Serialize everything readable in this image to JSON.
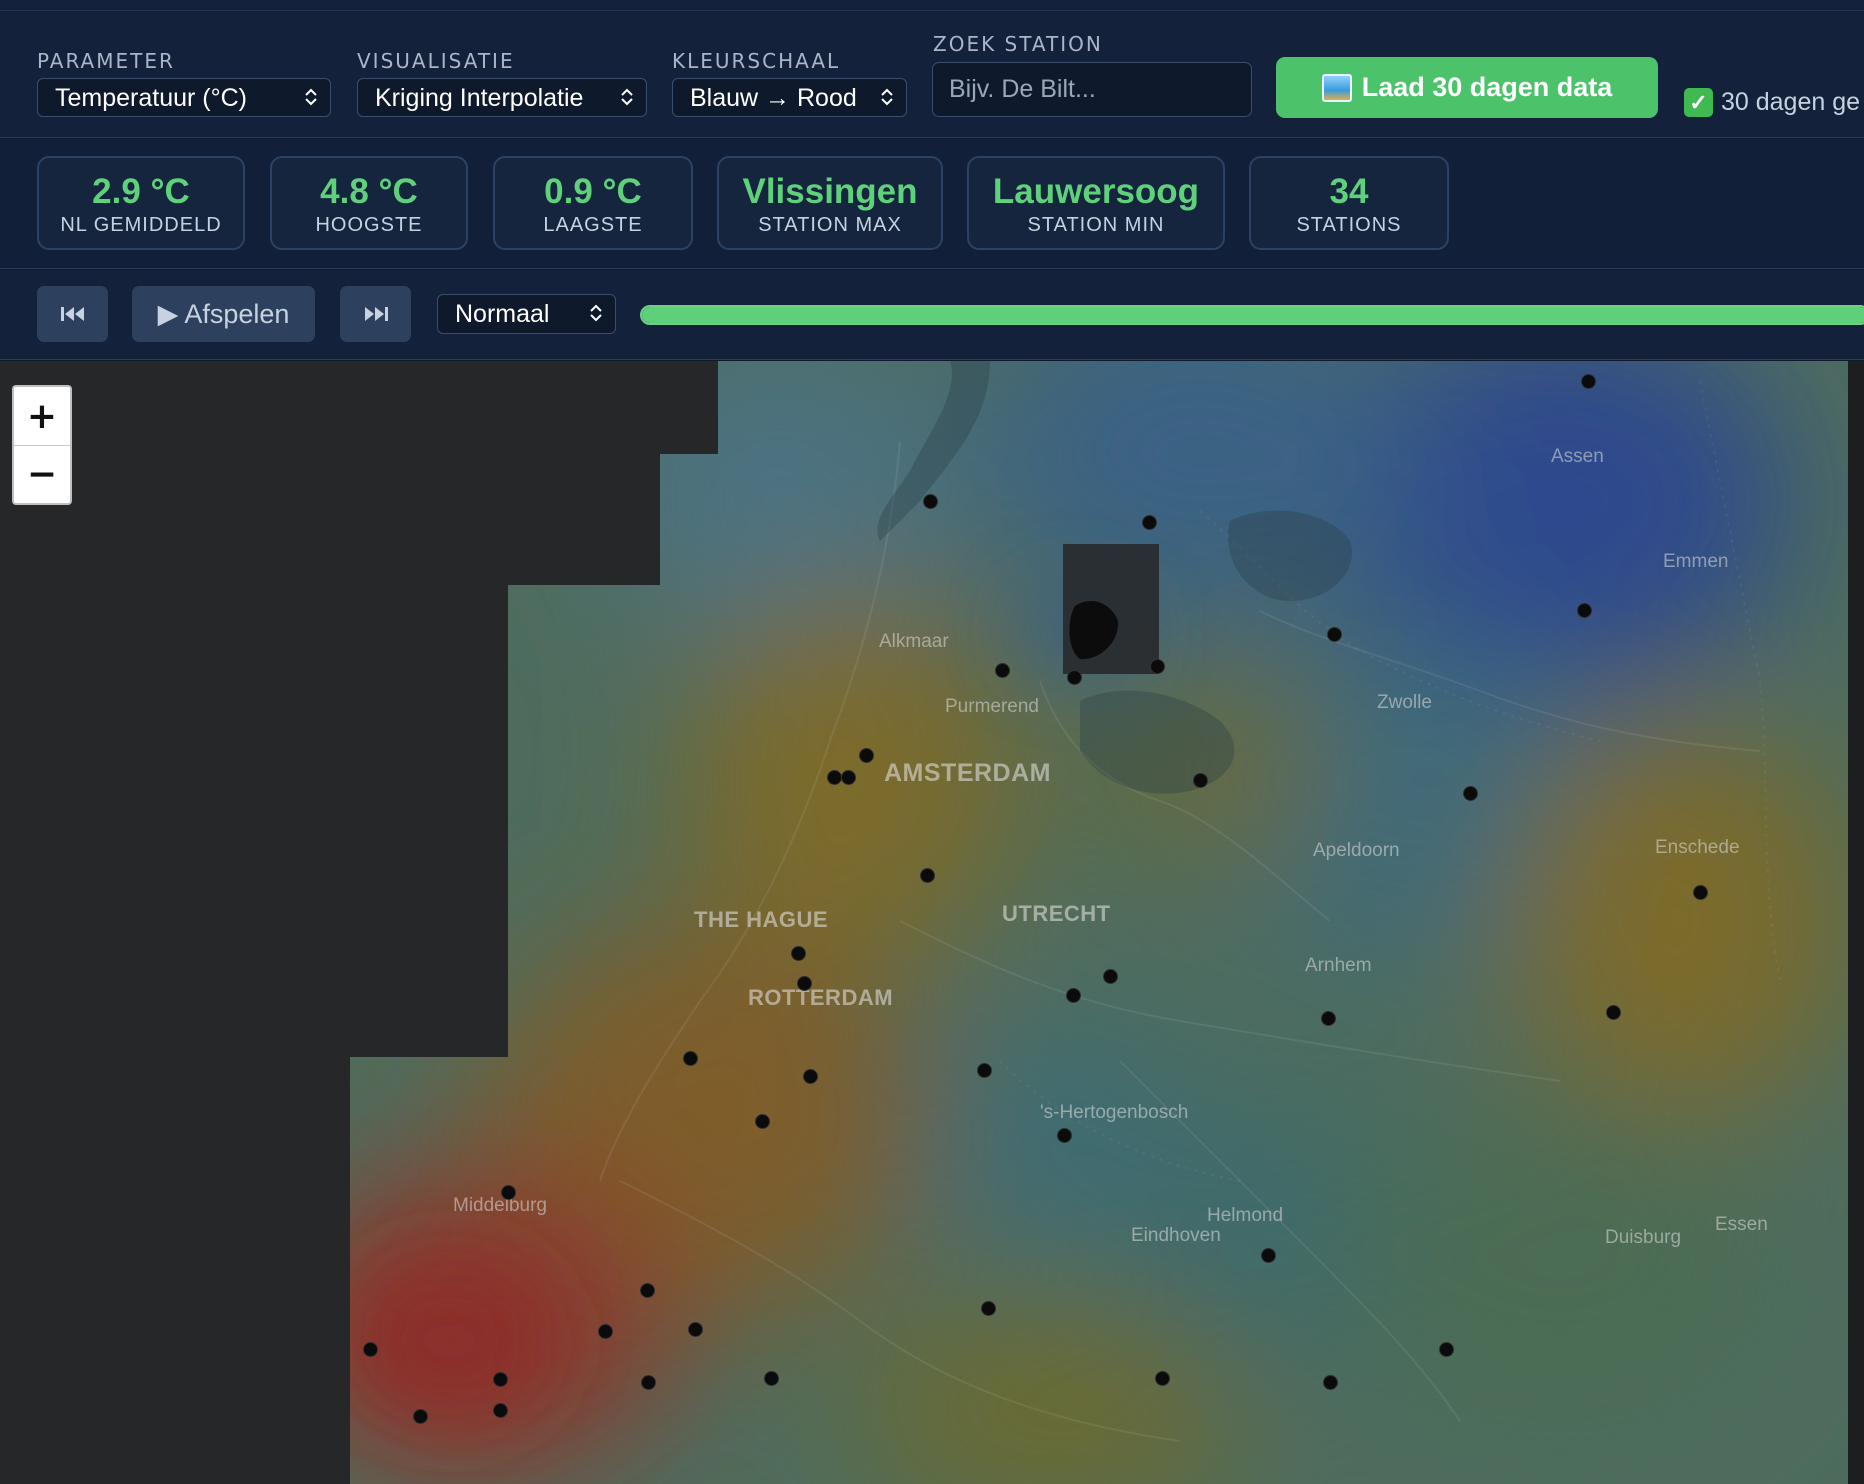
{
  "controls": {
    "parameter": {
      "label": "PARAMETER",
      "value": "Temperatuur (°C)"
    },
    "visualisatie": {
      "label": "VISUALISATIE",
      "value": "Kriging Interpolatie"
    },
    "kleurschaal": {
      "label": "KLEURSCHAAL",
      "value": "Blauw → Rood"
    },
    "search": {
      "label": "ZOEK STATION",
      "placeholder": "Bijv. De Bilt..."
    },
    "load_button": "Laad 30 dagen data",
    "status_text": "30 dagen ge"
  },
  "stats": [
    {
      "value": "2.9 °C",
      "label": "NL GEMIDDELD"
    },
    {
      "value": "4.8 °C",
      "label": "HOOGSTE"
    },
    {
      "value": "0.9 °C",
      "label": "LAAGSTE"
    },
    {
      "value": "Vlissingen",
      "label": "STATION MAX"
    },
    {
      "value": "Lauwersoog",
      "label": "STATION MIN"
    },
    {
      "value": "34",
      "label": "STATIONS"
    }
  ],
  "playback": {
    "prev_icon": "skip-back-icon",
    "play_label": "▶ Afspelen",
    "next_icon": "skip-forward-icon",
    "speed": "Normaal",
    "progress": 1.0
  },
  "map": {
    "zoom_in": "+",
    "zoom_out": "−",
    "cities": {
      "assen": "Assen",
      "emmen": "Emmen",
      "alkmaar": "Alkmaar",
      "purmerend": "Purmerend",
      "zwolle": "Zwolle",
      "amsterdam": "AMSTERDAM",
      "apeldoorn": "Apeldoorn",
      "enschede": "Enschede",
      "the_hague": "THE HAGUE",
      "utrecht": "UTRECHT",
      "arnhem": "Arnhem",
      "rotterdam": "ROTTERDAM",
      "hertogenbosch": "'s-Hertogenbosch",
      "middelburg": "Middelburg",
      "helmond": "Helmond",
      "eindhoven": "Eindhoven",
      "duisburg": "Duisburg",
      "essen": "Essen"
    },
    "colors": {
      "cold": "#2e4d8c",
      "cool": "#3f6a7a",
      "mild": "#56734e",
      "warm": "#7a6a2e",
      "hot": "#8a3a30"
    }
  }
}
